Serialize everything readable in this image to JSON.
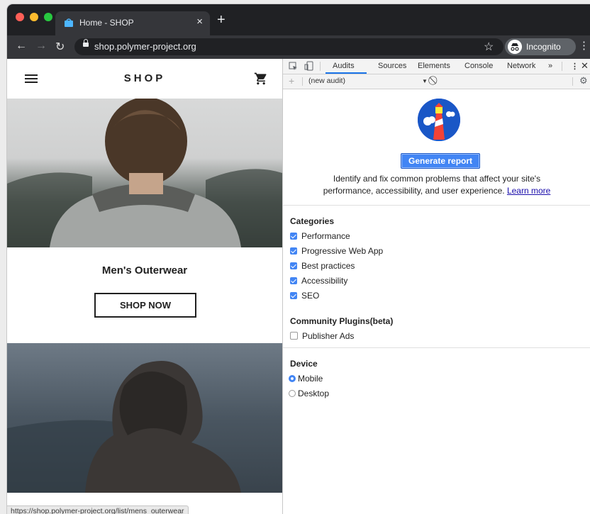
{
  "browser": {
    "tab_title": "Home - SHOP",
    "tab_close": "×",
    "new_tab": "+",
    "url": "shop.polymer-project.org",
    "incognito_label": "Incognito",
    "status_url": "https://shop.polymer-project.org/list/mens_outerwear"
  },
  "page": {
    "logo": "SHOP",
    "category_title": "Men's Outerwear",
    "shop_now": "SHOP NOW"
  },
  "devtools": {
    "tabs": [
      "Audits",
      "Sources",
      "Elements",
      "Console",
      "Network",
      "»"
    ],
    "audit_select": "(new audit)",
    "generate_button": "Generate report",
    "description": "Identify and fix common problems that affect your site's performance, accessibility, and user experience.",
    "learn_more": "Learn more",
    "categories_title": "Categories",
    "categories": [
      "Performance",
      "Progressive Web App",
      "Best practices",
      "Accessibility",
      "SEO"
    ],
    "plugins_title": "Community Plugins(beta)",
    "plugins": [
      "Publisher Ads"
    ],
    "device_title": "Device",
    "devices": [
      "Mobile",
      "Desktop"
    ],
    "selected_device": "Mobile"
  },
  "colors": {
    "tabbar": "#202124",
    "toolbar": "#35363a",
    "accent": "#4285f4",
    "link": "#1a0dab"
  }
}
